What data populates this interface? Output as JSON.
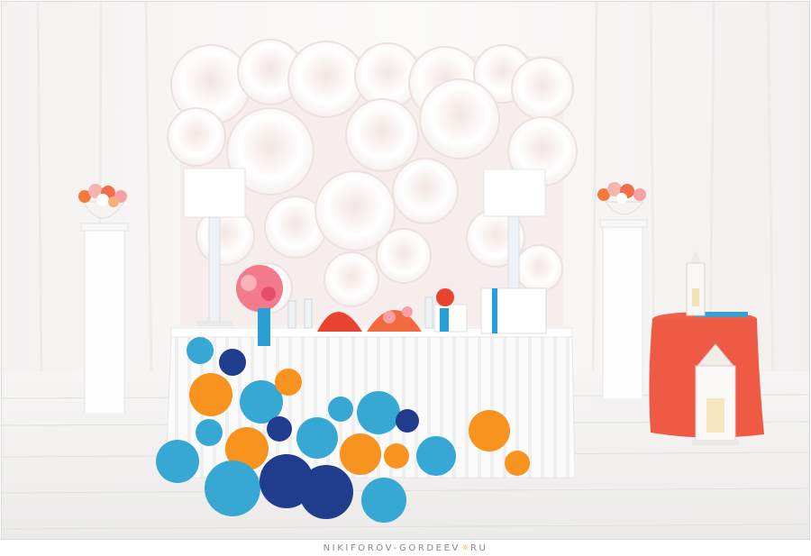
{
  "photo": {
    "description_colors": {
      "backdrop": "#ffffff",
      "curtain": "#f3f1f0",
      "floor": "#f1efee",
      "tablecloth": "#fbfbfb",
      "accent_orange": "#f7931e",
      "accent_turquoise": "#2aa3cc",
      "accent_navy": "#1f3a8a",
      "accent_coral": "#ef5a43"
    }
  },
  "watermark": {
    "part1": "NIKIFOROV-GORDEEV",
    "sun_glyph": "☼",
    "part2": "RU"
  }
}
